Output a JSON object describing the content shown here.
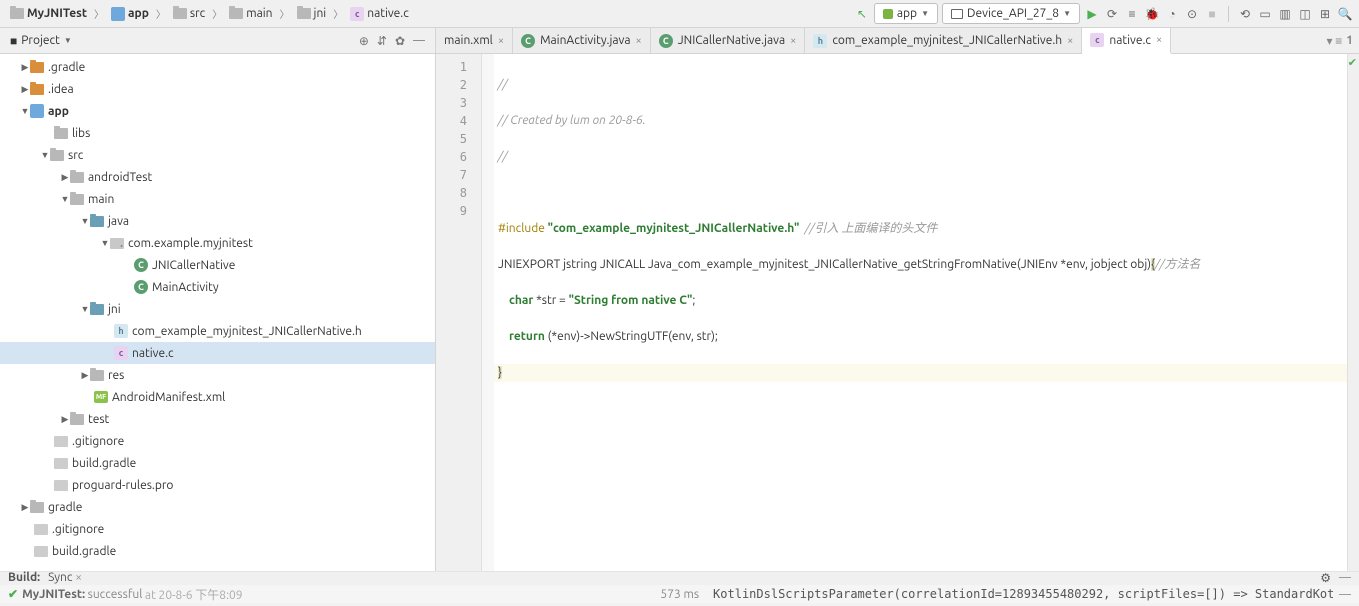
{
  "breadcrumb": {
    "root": "MyJNITest",
    "app": "app",
    "src": "src",
    "main": "main",
    "jni": "jni",
    "file": "native.c"
  },
  "toolbar": {
    "config": "app",
    "device": "Device_API_27_8"
  },
  "sidebar": {
    "title": "Project",
    "tree": {
      "gradle": ".gradle",
      "idea": ".idea",
      "app": "app",
      "libs": "libs",
      "src": "src",
      "androidTest": "androidTest",
      "main": "main",
      "java": "java",
      "pkg": "com.example.myjnitest",
      "jniCaller": "JNICallerNative",
      "mainActivity": "MainActivity",
      "jni": "jni",
      "header": "com_example_myjnitest_JNICallerNative.h",
      "nativec": "native.c",
      "res": "res",
      "manifest": "AndroidManifest.xml",
      "test": "test",
      "gitignore": ".gitignore",
      "buildGradle": "build.gradle",
      "proguard": "proguard-rules.pro",
      "gradleDir": "gradle",
      "gitignore2": ".gitignore",
      "buildGradle2": "build.gradle"
    }
  },
  "tabs": {
    "t0": "main.xml",
    "t1": "MainActivity.java",
    "t2": "JNICallerNative.java",
    "t3": "com_example_myjnitest_JNICallerNative.h",
    "t4": "native.c"
  },
  "code": {
    "l1": "//",
    "l2": "// Created by lum on 20-8-6.",
    "l3": "//",
    "l4": "",
    "l5a": "#include",
    "l5b": "\"com_example_myjnitest_JNICallerNative.h\"",
    "l5c": "  //引入 上面编译的头文件",
    "l6a": "JNIEXPORT jstring JNICALL Java_com_example_myjnitest_JNICallerNative_getStringFromNative(JNIEnv *env, jobject obj)",
    "l6b": "{",
    "l6c": "//方法名",
    "l7a": "char",
    "l7b": " *str = ",
    "l7c": "\"String from native C\"",
    "l7d": ";",
    "l8a": "return",
    "l8b": " (*env)->NewStringUTF(env, str);",
    "l9": "}"
  },
  "gutter": {
    "l1": "1",
    "l2": "2",
    "l3": "3",
    "l4": "4",
    "l5": "5",
    "l6": "6",
    "l7": "7",
    "l8": "8",
    "l9": "9"
  },
  "status": {
    "build": "Build:",
    "sync": "Sync",
    "project": "MyJNITest:",
    "result": "successful",
    "time": "at 20-8-6 下午8:09",
    "duration": "573 ms",
    "kotlin": "KotlinDslScriptsParameter(correlationId=12893455480292, scriptFiles=[]) => StandardKotlinDslScriptsModel(scr"
  }
}
